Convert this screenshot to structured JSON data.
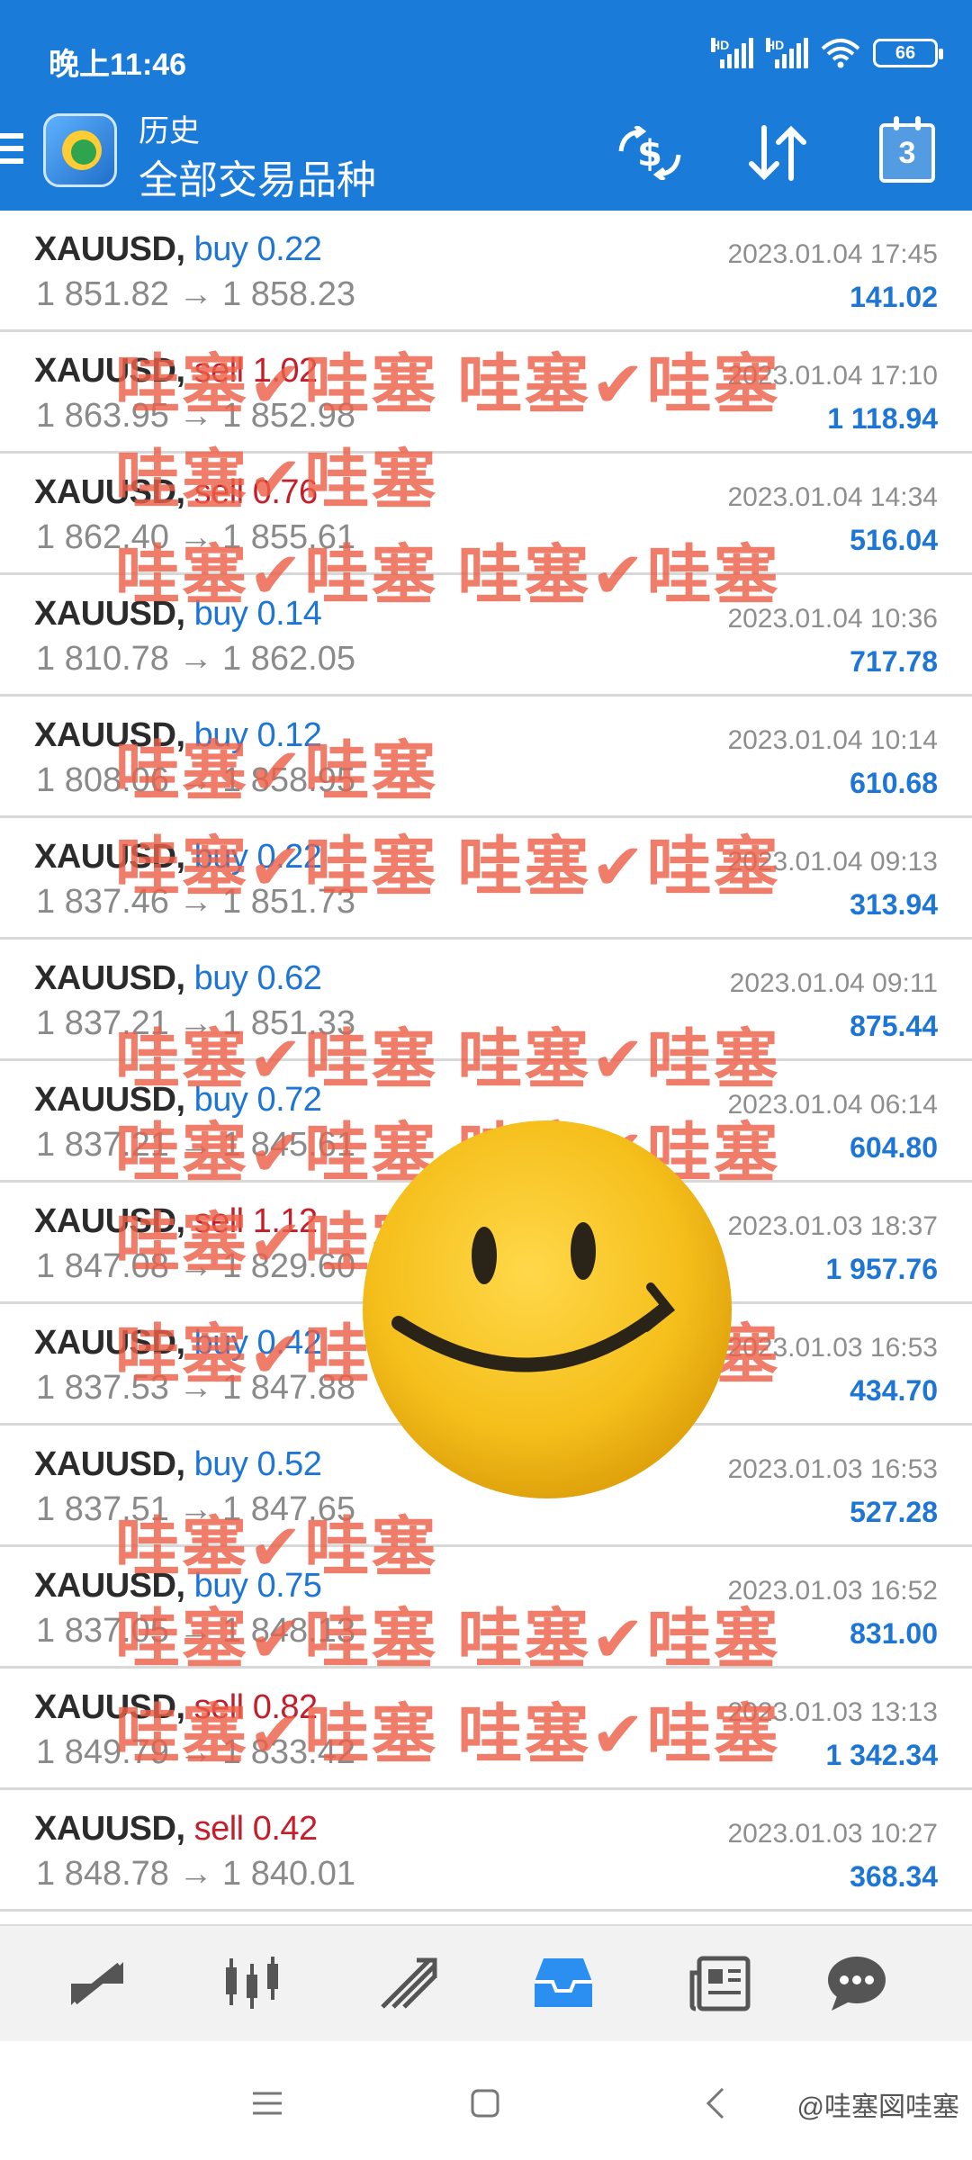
{
  "status_bar": {
    "time": "晚上11:46",
    "battery": "66",
    "net1": "HD",
    "net2": "HD"
  },
  "header": {
    "subtitle": "历史",
    "title": "全部交易品种",
    "calendar_day": "3"
  },
  "trades": [
    {
      "symbol": "XAUUSD,",
      "side": "buy",
      "volume": "0.22",
      "open": "1 851.82",
      "close": "1 858.23",
      "time": "2023.01.04 17:45",
      "profit": "141.02"
    },
    {
      "symbol": "XAUUSD,",
      "side": "sell",
      "volume": "1.02",
      "open": "1 863.95",
      "close": "1 852.98",
      "time": "2023.01.04 17:10",
      "profit": "1 118.94"
    },
    {
      "symbol": "XAUUSD,",
      "side": "sell",
      "volume": "0.76",
      "open": "1 862.40",
      "close": "1 855.61",
      "time": "2023.01.04 14:34",
      "profit": "516.04"
    },
    {
      "symbol": "XAUUSD,",
      "side": "buy",
      "volume": "0.14",
      "open": "1 810.78",
      "close": "1 862.05",
      "time": "2023.01.04 10:36",
      "profit": "717.78"
    },
    {
      "symbol": "XAUUSD,",
      "side": "buy",
      "volume": "0.12",
      "open": "1 808.06",
      "close": "1 858.95",
      "time": "2023.01.04 10:14",
      "profit": "610.68"
    },
    {
      "symbol": "XAUUSD,",
      "side": "buy",
      "volume": "0.22",
      "open": "1 837.46",
      "close": "1 851.73",
      "time": "2023.01.04 09:13",
      "profit": "313.94"
    },
    {
      "symbol": "XAUUSD,",
      "side": "buy",
      "volume": "0.62",
      "open": "1 837.21",
      "close": "1 851.33",
      "time": "2023.01.04 09:11",
      "profit": "875.44"
    },
    {
      "symbol": "XAUUSD,",
      "side": "buy",
      "volume": "0.72",
      "open": "1 837.21",
      "close": "1 845.61",
      "time": "2023.01.04 06:14",
      "profit": "604.80"
    },
    {
      "symbol": "XAUUSD,",
      "side": "sell",
      "volume": "1.12",
      "open": "1 847.08",
      "close": "1 829.60",
      "time": "2023.01.03 18:37",
      "profit": "1 957.76"
    },
    {
      "symbol": "XAUUSD,",
      "side": "buy",
      "volume": "0.42",
      "open": "1 837.53",
      "close": "1 847.88",
      "time": "2023.01.03 16:53",
      "profit": "434.70"
    },
    {
      "symbol": "XAUUSD,",
      "side": "buy",
      "volume": "0.52",
      "open": "1 837.51",
      "close": "1 847.65",
      "time": "2023.01.03 16:53",
      "profit": "527.28"
    },
    {
      "symbol": "XAUUSD,",
      "side": "buy",
      "volume": "0.75",
      "open": "1 837.05",
      "close": "1 848.13",
      "time": "2023.01.03 16:52",
      "profit": "831.00"
    },
    {
      "symbol": "XAUUSD,",
      "side": "sell",
      "volume": "0.82",
      "open": "1 849.79",
      "close": "1 833.42",
      "time": "2023.01.03 13:13",
      "profit": "1 342.34"
    },
    {
      "symbol": "XAUUSD,",
      "side": "sell",
      "volume": "0.42",
      "open": "1 848.78",
      "close": "1 840.01",
      "time": "2023.01.03 10:27",
      "profit": "368.34"
    }
  ],
  "arrow": "→",
  "colors": {
    "header": "#1b7bd8",
    "buy": "#1d75d6",
    "sell": "#c41e2a",
    "profit": "#1d75d6",
    "active_nav": "#2a8ff0"
  },
  "watermark": {
    "long": "哇塞✔哇塞 哇塞✔哇塞",
    "short": "哇塞✔哇塞"
  },
  "credit": "@哇塞図哇塞",
  "bottom_nav": [
    "exchange-icon",
    "chart-icon",
    "trade-icon",
    "history-icon",
    "news-icon",
    "chat-icon"
  ]
}
